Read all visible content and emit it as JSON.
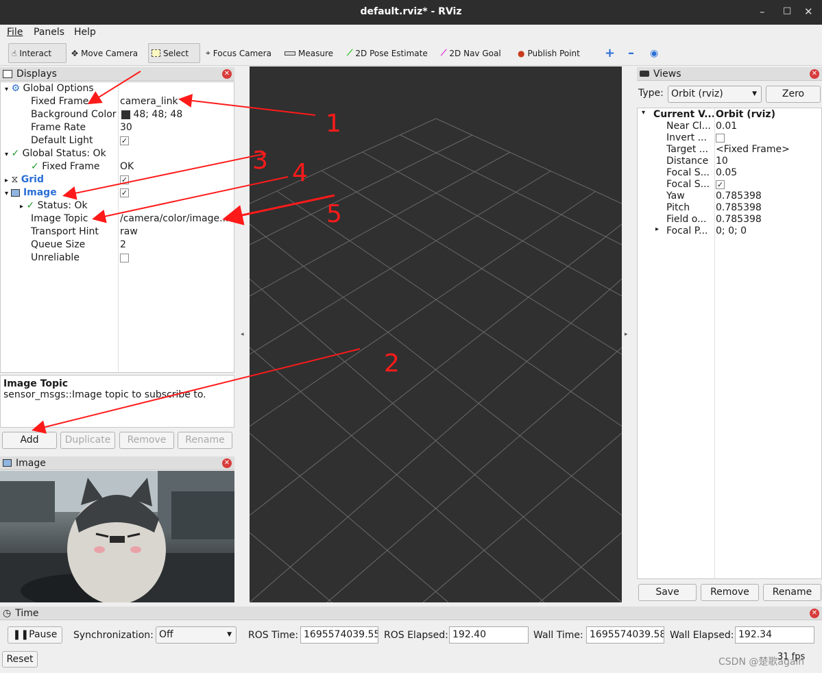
{
  "window": {
    "title": "default.rviz* - RViz",
    "controls": [
      "–",
      "□",
      "✕"
    ]
  },
  "menu": [
    "File",
    "Panels",
    "Help"
  ],
  "toolbar": {
    "tools": [
      {
        "label": "Interact",
        "icon": "hand-icon"
      },
      {
        "label": "Move Camera",
        "icon": "move-camera-icon"
      },
      {
        "label": "Select",
        "icon": "select-rect-icon"
      },
      {
        "label": "Focus Camera",
        "icon": "crosshair-icon"
      },
      {
        "label": "Measure",
        "icon": "ruler-icon"
      },
      {
        "label": "2D Pose Estimate",
        "icon": "green-arrow-icon"
      },
      {
        "label": "2D Nav Goal",
        "icon": "magenta-arrow-icon"
      },
      {
        "label": "Publish Point",
        "icon": "map-pin-icon"
      }
    ],
    "extras": [
      "plus-icon",
      "minus-icon",
      "eye-icon"
    ]
  },
  "displays": {
    "title": "Displays",
    "global_options": "Global Options",
    "fixed_frame": {
      "label": "Fixed Frame",
      "value": "camera_link"
    },
    "background_color": {
      "label": "Background Color",
      "value": "48; 48; 48",
      "swatch": "#303030"
    },
    "frame_rate": {
      "label": "Frame Rate",
      "value": "30"
    },
    "default_light": {
      "label": "Default Light"
    },
    "global_status": "Global Status: Ok",
    "gs_fixed_frame": {
      "label": "Fixed Frame",
      "value": "OK"
    },
    "grid": "Grid",
    "image": "Image",
    "status": "Status: Ok",
    "image_topic": {
      "label": "Image Topic",
      "value": "/camera/color/image..."
    },
    "transport_hint": {
      "label": "Transport Hint",
      "value": "raw"
    },
    "queue_size": {
      "label": "Queue Size",
      "value": "2"
    },
    "unreliable": {
      "label": "Unreliable"
    }
  },
  "description": {
    "title": "Image Topic",
    "text": "sensor_msgs::Image topic to subscribe to."
  },
  "display_buttons": [
    "Add",
    "Duplicate",
    "Remove",
    "Rename"
  ],
  "image_panel": {
    "title": "Image"
  },
  "views": {
    "title": "Views",
    "type_label": "Type:",
    "type_value": "Orbit (rviz)",
    "zero": "Zero",
    "current_view": {
      "label": "Current V...",
      "value": "Orbit (rviz)"
    },
    "props": [
      {
        "n": "Near Cl...",
        "v": "0.01"
      },
      {
        "n": "Invert ...",
        "v": ""
      },
      {
        "n": "Target ...",
        "v": "<Fixed Frame>"
      },
      {
        "n": "Distance",
        "v": "10"
      },
      {
        "n": "Focal S...",
        "v": "0.05"
      },
      {
        "n": "Focal S...",
        "v": ""
      },
      {
        "n": "Yaw",
        "v": "0.785398"
      },
      {
        "n": "Pitch",
        "v": "0.785398"
      },
      {
        "n": "Field o...",
        "v": "0.785398"
      },
      {
        "n": "Focal P...",
        "v": "0; 0; 0"
      }
    ],
    "buttons": [
      "Save",
      "Remove",
      "Rename"
    ]
  },
  "time": {
    "title": "Time",
    "pause": "Pause",
    "sync_label": "Synchronization:",
    "sync_value": "Off",
    "ros_time_label": "ROS Time:",
    "ros_time": "1695574039.55",
    "ros_elapsed_label": "ROS Elapsed:",
    "ros_elapsed": "192.40",
    "wall_time_label": "Wall Time:",
    "wall_time": "1695574039.58",
    "wall_elapsed_label": "Wall Elapsed:",
    "wall_elapsed": "192.34",
    "reset": "Reset",
    "fps": "31 fps",
    "watermark": "CSDN @楚歌again"
  },
  "annotations": [
    "1",
    "2",
    "3",
    "4",
    "5"
  ]
}
